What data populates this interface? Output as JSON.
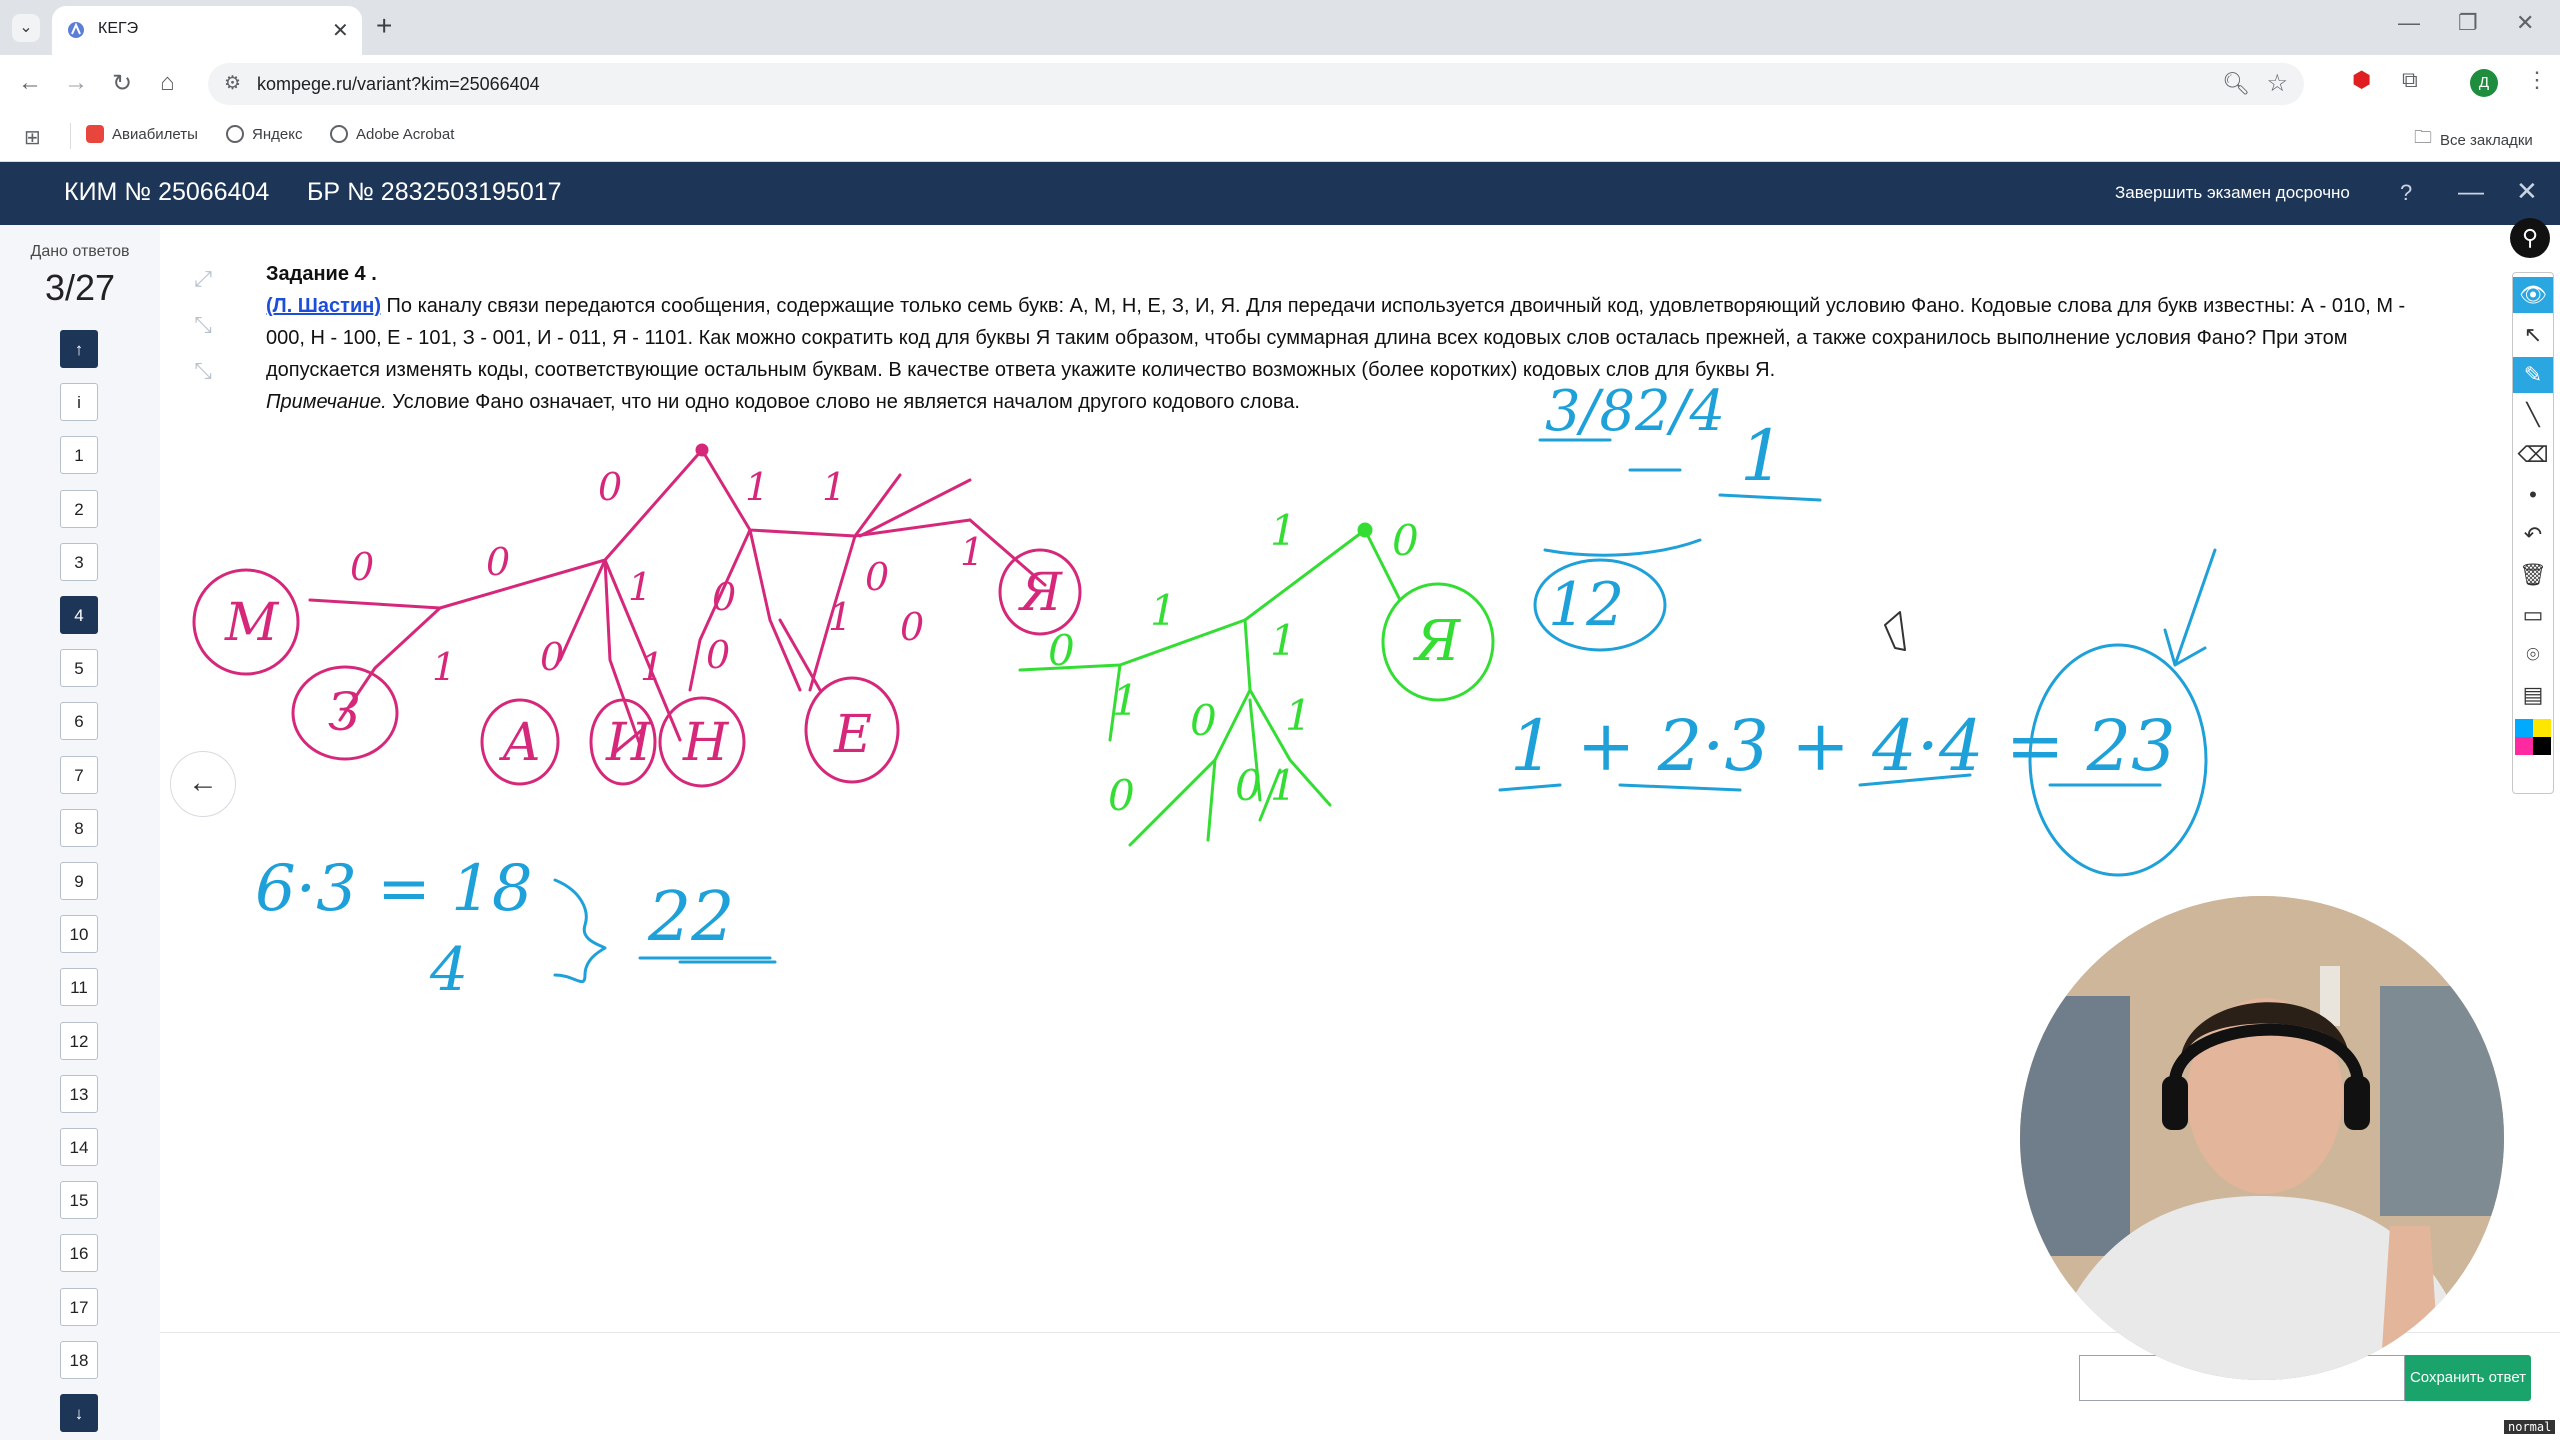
{
  "browser": {
    "tab_title": "КЕГЭ",
    "url": "kompege.ru/variant?kim=25066404",
    "bookmarks": [
      "Авиабилеты",
      "Яндекс",
      "Adobe Acrobat"
    ],
    "all_bookmarks": "Все закладки",
    "profile_initial": "Д"
  },
  "exam": {
    "kim": "КИМ № 25066404",
    "br": "БР № 2832503195017",
    "finish_label": "Завершить экзамен досрочно",
    "help": "?"
  },
  "sidebar": {
    "answers_label": "Дано ответов",
    "answers_count": "3/27",
    "items": [
      "↑",
      "i",
      "1",
      "2",
      "3",
      "4",
      "5",
      "6",
      "7",
      "8",
      "9",
      "10",
      "11",
      "12",
      "13",
      "14",
      "15",
      "16",
      "17",
      "18",
      "↓"
    ],
    "active_item": "4"
  },
  "task": {
    "title": "Задание 4 .",
    "author": "(Л. Шастин)",
    "text": "По каналу связи передаются сообщения, содержащие только семь букв: А, М, Н, Е, З, И, Я. Для передачи используется двоичный код, удовлетворяющий условию Фано. Кодовые слова для букв известны: А - 010, М - 000, Н - 100, Е - 101, З - 001, И - 011, Я - 1101. Как можно сократить код для буквы Я таким образом, чтобы суммарная длина всех кодовых слов осталась прежней, а также сохранилось выполнение условия Фано? При этом допускается изменять коды, соответствующие остальным буквам. В качестве ответа укажите количество возможных (более коротких) кодовых слов для буквы Я.",
    "note_label": "Примечание.",
    "note_text": "Условие Фано означает, что ни одно кодовое слово не является началом другого кодового слова."
  },
  "answer": {
    "input_value": "",
    "save_label": "Сохранить ответ"
  },
  "status": {
    "mode": "normal"
  },
  "colors": {
    "header_bg": "#1d3557",
    "magenta_ink": "#d6287a",
    "green_ink": "#33dd33",
    "blue_ink": "#1ea0d8",
    "save_button": "#1aa36b"
  },
  "handwriting": {
    "magenta_tree_letters": [
      "М",
      "З",
      "А",
      "И",
      "Н",
      "Е",
      "Я"
    ],
    "magenta_edge_labels": [
      "0",
      "0",
      "1",
      "0",
      "1",
      "0",
      "1",
      "1",
      "0",
      "1",
      "0",
      "1",
      "0",
      "1",
      "0"
    ],
    "green_tree_letters": [
      "Я"
    ],
    "green_edge_labels": [
      "0",
      "1",
      "0",
      "1",
      "1",
      "0",
      "1",
      "0",
      "1",
      "0",
      "1"
    ],
    "fractions": [
      "3/8",
      "2/4",
      "1"
    ],
    "circled_12": "12",
    "equation_sum": "1 + 2·3 + 4·4 = 23",
    "equation_left": "6·3 = 18",
    "equation_left_2": "4",
    "equation_left_result": "22"
  }
}
